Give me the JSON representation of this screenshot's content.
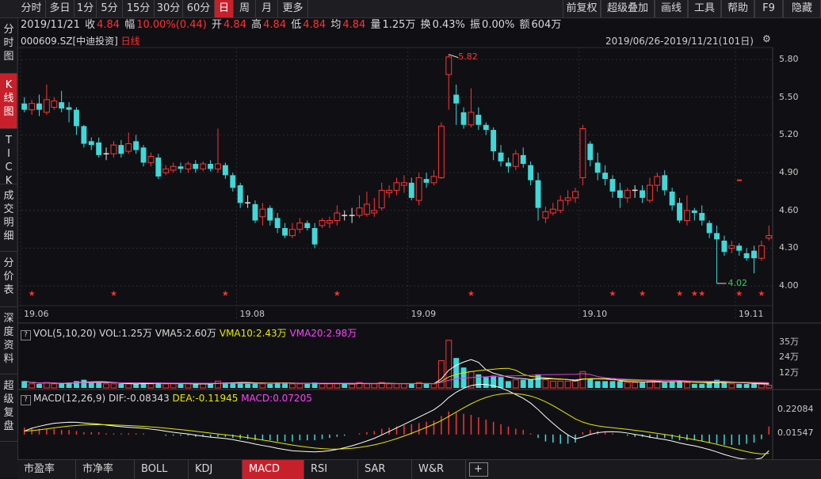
{
  "toolbar": {
    "left": [
      "分时",
      "多日",
      "1分",
      "5分",
      "15分",
      "30分",
      "60分",
      "日",
      "周",
      "月",
      "更多"
    ],
    "right": [
      "前复权",
      "超级叠加",
      "画线",
      "工具",
      "帮助",
      "F9",
      "隐藏"
    ],
    "active": "日"
  },
  "sidebar": [
    "分时图",
    "K线图",
    "TICK",
    "成交明细",
    "分价表",
    "深度资料",
    "超级复盘"
  ],
  "quote": {
    "date": "2019/11/21",
    "close_label": "收",
    "close": "4.84",
    "change_label": "幅",
    "change": "10.00%(0.44)",
    "open_label": "开",
    "open": "4.84",
    "high_label": "高",
    "high": "4.84",
    "low_label": "低",
    "low": "4.84",
    "avg_label": "均",
    "avg": "4.84",
    "volume_label": "量",
    "volume": "1.25万",
    "turnover_label": "换",
    "turnover": "0.43%",
    "amplitude_label": "振",
    "amplitude": "0.00%",
    "amount_label": "额",
    "amount": "604万"
  },
  "stock": {
    "code": "000609.SZ",
    "name": "[中迪投资]",
    "period": "日线"
  },
  "range": "2019/06/26-2019/11/21(101日)",
  "price_axis": [
    "5.80",
    "5.50",
    "5.20",
    "4.90",
    "4.60",
    "4.30",
    "4.00"
  ],
  "date_axis": [
    "19.06",
    "19.08",
    "19.09",
    "19.10",
    "19.11"
  ],
  "max_marker": "5.82",
  "min_marker": "4.02",
  "vol": {
    "title": "VOL(5,10,20)",
    "vol": "VOL:1.25万",
    "vma5": "VMA5:2.60万",
    "vma10": "VMA10:2.43万",
    "vma20": "VMA20:2.98万",
    "axis": [
      "35万",
      "24万",
      "12万"
    ]
  },
  "macd": {
    "title": "MACD(12,26,9)",
    "dif": "DIF:-0.08343",
    "dea": "DEA:-0.11945",
    "macd": "MACD:0.07205",
    "axis": [
      "0.22084",
      "0.01547"
    ]
  },
  "bottom_tabs": [
    "市盈率",
    "市净率",
    "BOLL",
    "KDJ",
    "MACD",
    "RSI",
    "SAR",
    "W&R",
    "+"
  ],
  "bottom_active": "MACD",
  "colors": {
    "up": "#ff3333",
    "down": "#40d8d8",
    "vma5": "#ffffff",
    "vma10": "#e8e800",
    "vma20": "#e040e0",
    "accent": "#c8202a"
  },
  "chart_data": {
    "type": "candlestick",
    "title": "000609.SZ [中迪投资] 日线",
    "date_range": "2019/06/26-2019/11/21",
    "ylim": [
      3.85,
      5.92
    ],
    "candles": [
      [
        5.45,
        5.4,
        5.5,
        5.38
      ],
      [
        5.4,
        5.45,
        5.48,
        5.36
      ],
      [
        5.45,
        5.4,
        5.52,
        5.35
      ],
      [
        5.38,
        5.48,
        5.6,
        5.36
      ],
      [
        5.42,
        5.47,
        5.5,
        5.4
      ],
      [
        5.46,
        5.41,
        5.55,
        5.38
      ],
      [
        5.42,
        5.4,
        5.46,
        5.3
      ],
      [
        5.4,
        5.27,
        5.42,
        5.2
      ],
      [
        5.27,
        5.13,
        5.28,
        5.1
      ],
      [
        5.15,
        5.12,
        5.18,
        5.08
      ],
      [
        5.14,
        5.04,
        5.18,
        5.02
      ],
      [
        5.05,
        5.05,
        5.1,
        5.0
      ],
      [
        5.05,
        5.12,
        5.15,
        5.02
      ],
      [
        5.12,
        5.05,
        5.16,
        5.02
      ],
      [
        5.07,
        5.13,
        5.22,
        5.05
      ],
      [
        5.15,
        5.08,
        5.2,
        5.05
      ],
      [
        5.1,
        4.98,
        5.12,
        4.95
      ],
      [
        4.98,
        5.03,
        5.06,
        4.95
      ],
      [
        5.02,
        4.87,
        5.05,
        4.85
      ],
      [
        4.9,
        4.93,
        4.96,
        4.88
      ],
      [
        4.92,
        4.95,
        4.98,
        4.9
      ],
      [
        4.95,
        4.93,
        4.98,
        4.9
      ],
      [
        4.93,
        4.97,
        4.99,
        4.9
      ],
      [
        4.97,
        4.93,
        5.0,
        4.9
      ],
      [
        4.93,
        4.97,
        4.99,
        4.91
      ],
      [
        4.97,
        4.93,
        5.0,
        4.91
      ],
      [
        4.93,
        4.97,
        5.25,
        4.9
      ],
      [
        4.96,
        4.88,
        4.98,
        4.85
      ],
      [
        4.88,
        4.78,
        4.9,
        4.75
      ],
      [
        4.8,
        4.66,
        4.82,
        4.62
      ],
      [
        4.66,
        4.65,
        4.72,
        4.62
      ],
      [
        4.65,
        4.52,
        4.68,
        4.5
      ],
      [
        4.55,
        4.61,
        4.66,
        4.48
      ],
      [
        4.62,
        4.52,
        4.64,
        4.48
      ],
      [
        4.54,
        4.46,
        4.58,
        4.42
      ],
      [
        4.46,
        4.4,
        4.5,
        4.38
      ],
      [
        4.4,
        4.45,
        4.5,
        4.38
      ],
      [
        4.45,
        4.5,
        4.54,
        4.42
      ],
      [
        4.5,
        4.46,
        4.52,
        4.44
      ],
      [
        4.46,
        4.33,
        4.5,
        4.3
      ],
      [
        4.48,
        4.52,
        4.54,
        4.46
      ],
      [
        4.5,
        4.52,
        4.55,
        4.46
      ],
      [
        4.52,
        4.58,
        4.64,
        4.48
      ],
      [
        4.56,
        4.55,
        4.6,
        4.52
      ],
      [
        4.55,
        4.56,
        4.62,
        4.5
      ],
      [
        4.56,
        4.62,
        4.72,
        4.54
      ],
      [
        4.57,
        4.65,
        4.75,
        4.55
      ],
      [
        4.58,
        4.6,
        4.7,
        4.55
      ],
      [
        4.62,
        4.76,
        4.82,
        4.6
      ],
      [
        4.74,
        4.76,
        4.8,
        4.7
      ],
      [
        4.76,
        4.82,
        4.86,
        4.72
      ],
      [
        4.8,
        4.82,
        4.88,
        4.74
      ],
      [
        4.82,
        4.7,
        4.86,
        4.68
      ],
      [
        4.68,
        4.86,
        4.9,
        4.64
      ],
      [
        4.85,
        4.82,
        4.9,
        4.78
      ],
      [
        4.82,
        4.87,
        4.92,
        4.8
      ],
      [
        4.86,
        5.27,
        5.3,
        4.85
      ],
      [
        5.68,
        5.82,
        5.84,
        5.4
      ],
      [
        5.52,
        5.45,
        5.6,
        5.28
      ],
      [
        5.38,
        5.28,
        5.42,
        5.25
      ],
      [
        5.28,
        5.38,
        5.57,
        5.26
      ],
      [
        5.36,
        5.28,
        5.42,
        5.24
      ],
      [
        5.28,
        5.24,
        5.3,
        5.2
      ],
      [
        5.24,
        5.07,
        5.26,
        5.0
      ],
      [
        5.06,
        4.99,
        5.12,
        4.95
      ],
      [
        4.98,
        4.95,
        5.02,
        4.9
      ],
      [
        4.95,
        5.05,
        5.08,
        4.92
      ],
      [
        5.04,
        4.97,
        5.1,
        4.94
      ],
      [
        4.96,
        4.84,
        4.99,
        4.8
      ],
      [
        4.84,
        4.62,
        4.9,
        4.52
      ],
      [
        4.54,
        4.59,
        4.63,
        4.5
      ],
      [
        4.58,
        4.61,
        4.66,
        4.56
      ],
      [
        4.6,
        4.68,
        4.72,
        4.58
      ],
      [
        4.68,
        4.7,
        4.76,
        4.64
      ],
      [
        4.7,
        4.75,
        4.78,
        4.66
      ],
      [
        4.86,
        5.25,
        5.28,
        4.8
      ],
      [
        5.13,
        5.0,
        5.15,
        4.95
      ],
      [
        4.98,
        4.9,
        5.06,
        4.84
      ],
      [
        4.9,
        4.85,
        4.96,
        4.8
      ],
      [
        4.85,
        4.75,
        4.88,
        4.7
      ],
      [
        4.76,
        4.7,
        4.82,
        4.62
      ],
      [
        4.7,
        4.76,
        4.78,
        4.66
      ],
      [
        4.76,
        4.76,
        4.8,
        4.7
      ],
      [
        4.76,
        4.7,
        4.8,
        4.66
      ],
      [
        4.68,
        4.8,
        4.86,
        4.66
      ],
      [
        4.8,
        4.87,
        4.9,
        4.75
      ],
      [
        4.88,
        4.76,
        4.92,
        4.72
      ],
      [
        4.75,
        4.64,
        4.78,
        4.6
      ],
      [
        4.66,
        4.52,
        4.7,
        4.5
      ],
      [
        4.52,
        4.6,
        4.72,
        4.48
      ],
      [
        4.6,
        4.58,
        4.62,
        4.52
      ],
      [
        4.58,
        4.52,
        4.64,
        4.48
      ],
      [
        4.5,
        4.42,
        4.52,
        4.38
      ],
      [
        4.42,
        4.37,
        4.48,
        4.02
      ],
      [
        4.36,
        4.27,
        4.4,
        4.24
      ],
      [
        4.3,
        4.32,
        4.36,
        4.26
      ],
      [
        4.32,
        4.28,
        4.34,
        4.24
      ],
      [
        4.26,
        4.22,
        4.3,
        4.2
      ],
      [
        4.28,
        4.22,
        4.32,
        4.1
      ],
      [
        4.22,
        4.32,
        4.36,
        4.2
      ],
      [
        4.38,
        4.4,
        4.48,
        4.36
      ]
    ],
    "volume": [
      5,
      3,
      3,
      4,
      3,
      3,
      4,
      5,
      6,
      4,
      4,
      3,
      3,
      3,
      3,
      3,
      4,
      3,
      4,
      3,
      3,
      3,
      3,
      3,
      3,
      3,
      5,
      4,
      4,
      4,
      3,
      4,
      3,
      3,
      4,
      4,
      3,
      3,
      3,
      4,
      3,
      3,
      3,
      3,
      3,
      4,
      3,
      3,
      4,
      3,
      3,
      3,
      3,
      4,
      3,
      3,
      20,
      35,
      22,
      15,
      12,
      10,
      8,
      9,
      8,
      5,
      6,
      6,
      6,
      10,
      6,
      5,
      5,
      5,
      5,
      12,
      7,
      5,
      5,
      5,
      5,
      4,
      4,
      4,
      5,
      5,
      4,
      5,
      5,
      4,
      3,
      3,
      4,
      6,
      4,
      3,
      3,
      3,
      3,
      3,
      2
    ],
    "vma5_last": "2.60万",
    "vma10_last": "2.43万",
    "vma20_last": "2.98万",
    "macd_hist": [
      0.06,
      0.06,
      0.05,
      0.05,
      0.05,
      0.04,
      0.04,
      0.03,
      0.02,
      0.02,
      0.02,
      0.01,
      0.01,
      0.01,
      0.01,
      0.01,
      0.01,
      0.0,
      0.0,
      -0.01,
      -0.01,
      -0.01,
      -0.01,
      -0.02,
      -0.02,
      -0.02,
      -0.02,
      -0.02,
      -0.03,
      -0.04,
      -0.04,
      -0.05,
      -0.05,
      -0.05,
      -0.06,
      -0.06,
      -0.06,
      -0.05,
      -0.05,
      -0.05,
      -0.04,
      -0.03,
      -0.02,
      -0.01,
      0.0,
      0.01,
      0.02,
      0.03,
      0.05,
      0.06,
      0.07,
      0.08,
      0.09,
      0.1,
      0.11,
      0.12,
      0.16,
      0.2,
      0.19,
      0.18,
      0.17,
      0.15,
      0.13,
      0.11,
      0.09,
      0.07,
      0.05,
      0.04,
      0.01,
      -0.03,
      -0.06,
      -0.07,
      -0.08,
      -0.08,
      -0.07,
      0.02,
      0.04,
      0.03,
      0.02,
      0.01,
      0.0,
      -0.01,
      -0.02,
      -0.02,
      -0.03,
      -0.03,
      -0.03,
      -0.04,
      -0.05,
      -0.05,
      -0.05,
      -0.06,
      -0.07,
      -0.08,
      -0.09,
      -0.09,
      -0.09,
      -0.08,
      -0.07,
      -0.04,
      0.07
    ],
    "macd_ylim": [
      -0.18,
      0.26
    ],
    "macd_ticks": [
      0.22084,
      0.01547
    ],
    "vol_ylim": [
      0,
      36
    ],
    "vol_ticks": [
      35,
      24,
      12
    ],
    "star_index": [
      1,
      12,
      27,
      42,
      60,
      79,
      83,
      88,
      90,
      91,
      96,
      99
    ],
    "date_tick_index": [
      0,
      29,
      52,
      75,
      96
    ],
    "max_index": 57,
    "min_index": 93
  }
}
